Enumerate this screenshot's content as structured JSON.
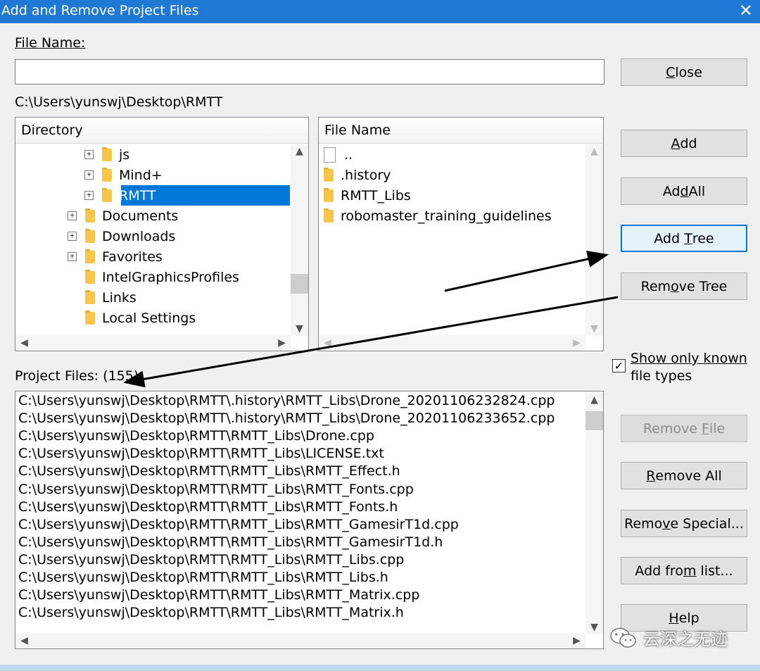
{
  "window": {
    "title": "Add and Remove Project Files",
    "close_glyph": "✕"
  },
  "file_name": {
    "label": "File Name:",
    "value": ""
  },
  "current_path": "C:\\Users\\yunswj\\Desktop\\RMTT",
  "directory": {
    "header": "Directory",
    "items": [
      {
        "label": "js",
        "expand": "+"
      },
      {
        "label": "Mind+",
        "expand": "+"
      },
      {
        "label": "RMTT",
        "expand": "+"
      },
      {
        "label": "Documents",
        "expand": "+"
      },
      {
        "label": "Downloads",
        "expand": "+"
      },
      {
        "label": "Favorites",
        "expand": "+"
      },
      {
        "label": "IntelGraphicsProfiles",
        "expand": ""
      },
      {
        "label": "Links",
        "expand": ""
      },
      {
        "label": "Local Settings",
        "expand": ""
      }
    ]
  },
  "files": {
    "header": "File Name",
    "items": [
      "..",
      ".history",
      "RMTT_Libs",
      "robomaster_training_guidelines"
    ]
  },
  "project_files": {
    "label": "Project Files: (155)",
    "items": [
      "C:\\Users\\yunswj\\Desktop\\RMTT\\.history\\RMTT_Libs\\Drone_20201106232824.cpp",
      "C:\\Users\\yunswj\\Desktop\\RMTT\\.history\\RMTT_Libs\\Drone_20201106233652.cpp",
      "C:\\Users\\yunswj\\Desktop\\RMTT\\RMTT_Libs\\Drone.cpp",
      "C:\\Users\\yunswj\\Desktop\\RMTT\\RMTT_Libs\\LICENSE.txt",
      "C:\\Users\\yunswj\\Desktop\\RMTT\\RMTT_Libs\\RMTT_Effect.h",
      "C:\\Users\\yunswj\\Desktop\\RMTT\\RMTT_Libs\\RMTT_Fonts.cpp",
      "C:\\Users\\yunswj\\Desktop\\RMTT\\RMTT_Libs\\RMTT_Fonts.h",
      "C:\\Users\\yunswj\\Desktop\\RMTT\\RMTT_Libs\\RMTT_GamesirT1d.cpp",
      "C:\\Users\\yunswj\\Desktop\\RMTT\\RMTT_Libs\\RMTT_GamesirT1d.h",
      "C:\\Users\\yunswj\\Desktop\\RMTT\\RMTT_Libs\\RMTT_Libs.cpp",
      "C:\\Users\\yunswj\\Desktop\\RMTT\\RMTT_Libs\\RMTT_Libs.h",
      "C:\\Users\\yunswj\\Desktop\\RMTT\\RMTT_Libs\\RMTT_Matrix.cpp",
      "C:\\Users\\yunswj\\Desktop\\RMTT\\RMTT_Libs\\RMTT_Matrix.h"
    ]
  },
  "buttons": {
    "close": {
      "pre": "",
      "key": "C",
      "post": "lose"
    },
    "add": {
      "pre": "",
      "key": "A",
      "post": "dd"
    },
    "add_all": {
      "pre": "Ad",
      "key": "d",
      "post": " All"
    },
    "add_tree": {
      "pre": "Add ",
      "key": "T",
      "post": "ree"
    },
    "remove_tree": {
      "pre": "Rem",
      "key": "o",
      "post": "ve Tree"
    },
    "remove_file": {
      "pre": "Remove ",
      "key": "F",
      "post": "ile"
    },
    "remove_all": {
      "pre": "",
      "key": "R",
      "post": "emove All"
    },
    "remove_special": {
      "pre": "Remo",
      "key": "v",
      "post": "e Special..."
    },
    "add_from_list": {
      "pre": "Add fro",
      "key": "m",
      "post": " list..."
    },
    "help": {
      "pre": "",
      "key": "H",
      "post": "elp"
    }
  },
  "show_known": {
    "label_line1": "Show only known",
    "label_line2": "file types",
    "checked": true,
    "check_glyph": "✓"
  },
  "watermark": {
    "text": "云深之无迹",
    "icon": "wechat-icon"
  },
  "arrows": {
    "color": "#000000"
  },
  "colors": {
    "accent": "#0078d7",
    "titlebar": "#1e78d4"
  }
}
